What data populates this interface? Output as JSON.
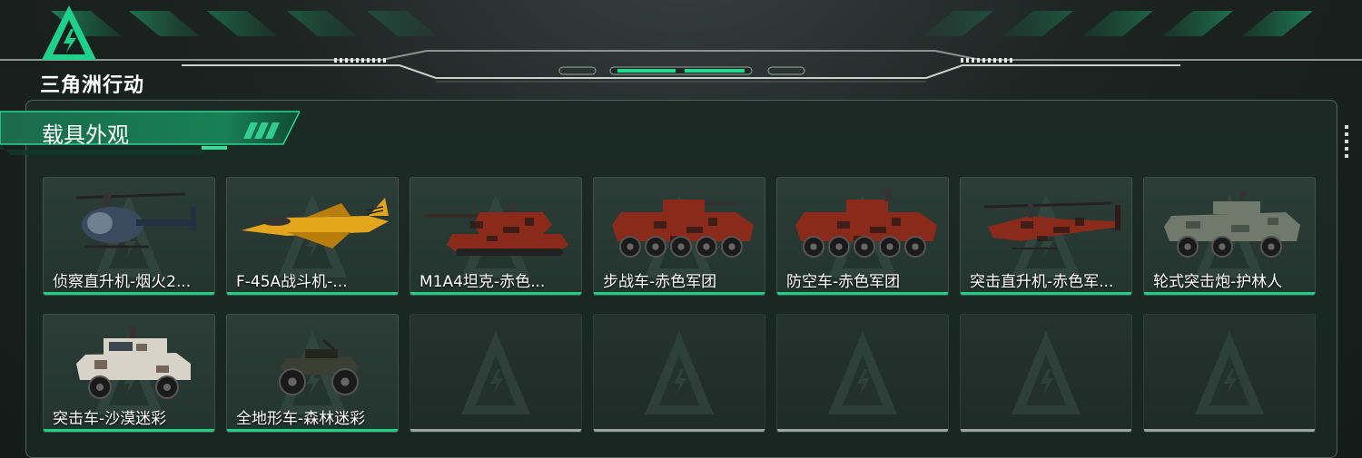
{
  "game": {
    "logo_text": "三角洲行动",
    "accent_color": "#1fcf86"
  },
  "section": {
    "title": "载具外观"
  },
  "vehicles": [
    {
      "name": "侦察直升机-烟火2...",
      "icon": "scout-helicopter",
      "camo": "navy"
    },
    {
      "name": "F-45A战斗机-...",
      "icon": "fighter-jet",
      "camo": "yellow"
    },
    {
      "name": "M1A4坦克-赤色...",
      "icon": "tank",
      "camo": "red"
    },
    {
      "name": "步战车-赤色军团",
      "icon": "ifv",
      "camo": "red"
    },
    {
      "name": "防空车-赤色军团",
      "icon": "aa-vehicle",
      "camo": "red"
    },
    {
      "name": "突击直升机-赤色军...",
      "icon": "attack-helicopter",
      "camo": "red"
    },
    {
      "name": "轮式突击炮-护林人",
      "icon": "wheeled-assault-gun",
      "camo": "green"
    },
    {
      "name": "突击车-沙漠迷彩",
      "icon": "assault-car",
      "camo": "desert"
    },
    {
      "name": "全地形车-森林迷彩",
      "icon": "atv",
      "camo": "forest"
    }
  ],
  "empty_slots": 5,
  "camo_colors": {
    "navy": [
      "#3b4a5e",
      "#23303f"
    ],
    "yellow": [
      "#e2a51c",
      "#b97d0e"
    ],
    "red": [
      "#8a2a1a",
      "#2e1a16"
    ],
    "green": [
      "#6f7a6c",
      "#3e4a3f"
    ],
    "desert": [
      "#d8d3c8",
      "#5a4c3e"
    ],
    "forest": [
      "#3a3e33",
      "#22261f"
    ]
  }
}
